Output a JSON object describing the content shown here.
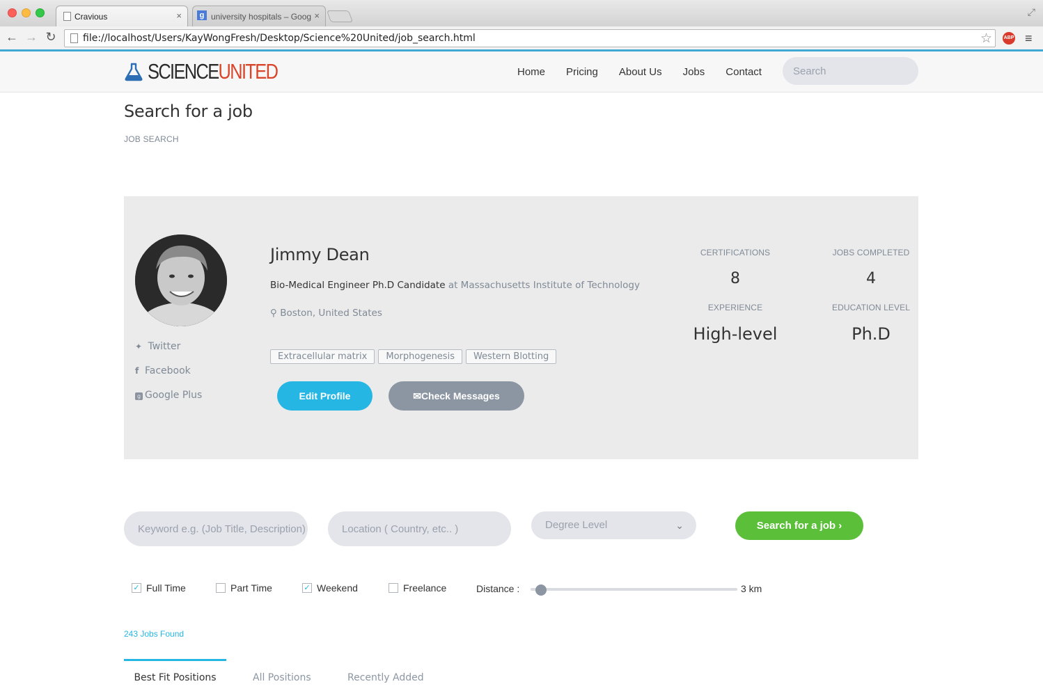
{
  "browser": {
    "tabs": [
      {
        "title": "Cravious",
        "close": "×"
      },
      {
        "title": "university hospitals – Goog",
        "close": "×"
      }
    ],
    "url": "file://localhost/Users/KayWongFresh/Desktop/Science%20United/job_search.html",
    "abp_label": "ABP"
  },
  "header": {
    "logo_science": "SCIENCE",
    "logo_united": "UNITED",
    "nav": [
      "Home",
      "Pricing",
      "About Us",
      "Jobs",
      "Contact"
    ],
    "search_placeholder": "Search"
  },
  "page": {
    "title": "Search for a job",
    "breadcrumb": "JOB SEARCH"
  },
  "profile": {
    "name": "Jimmy Dean",
    "role": "Bio-Medical Engineer Ph.D Candidate",
    "institution": "at Massachusetts Institute of Technology",
    "location": "Boston, United States",
    "social": [
      "Twitter",
      "Facebook",
      "Google Plus"
    ],
    "tags": [
      "Extracellular matrix",
      "Morphogenesis",
      "Western Blotting"
    ],
    "edit_button": "Edit Profile",
    "messages_button": "Check Messages",
    "stats": {
      "certifications_label": "CERTIFICATIONS",
      "certifications_value": "8",
      "jobs_completed_label": "JOBS COMPLETED",
      "jobs_completed_value": "4",
      "experience_label": "EXPERIENCE",
      "experience_value": "High-level",
      "education_label": "EDUCATION LEVEL",
      "education_value": "Ph.D"
    }
  },
  "search_form": {
    "keyword_placeholder": "Keyword e.g. (Job Title, Description)",
    "location_placeholder": "Location ( Country, etc.. )",
    "degree_placeholder": "Degree Level",
    "submit_label": "Search for a job",
    "filters": [
      {
        "label": "Full Time",
        "checked": true
      },
      {
        "label": "Part Time",
        "checked": false
      },
      {
        "label": "Weekend",
        "checked": true
      },
      {
        "label": "Freelance",
        "checked": false
      }
    ],
    "distance_label": "Distance :",
    "distance_value": "3 km"
  },
  "results": {
    "count_text": "243 Jobs Found",
    "tabs": [
      "Best Fit Positions",
      "All Positions",
      "Recently Added"
    ],
    "active_tab": 0
  },
  "colors": {
    "accent_blue": "#25b6e4",
    "brand_red": "#d9452b",
    "search_green": "#5cbf3a",
    "muted_gray": "#8c96a3"
  }
}
